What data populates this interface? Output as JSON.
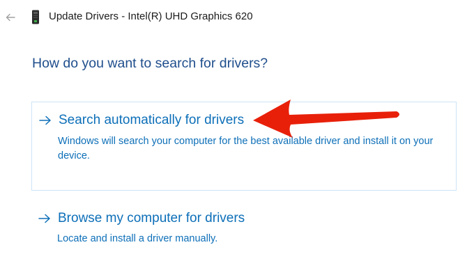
{
  "window": {
    "title": "Update Drivers - Intel(R) UHD Graphics 620",
    "back_icon": "back-arrow-icon",
    "device_icon": "graphics-card-icon"
  },
  "main": {
    "question": "How do you want to search for drivers?",
    "options": [
      {
        "title": "Search automatically for drivers",
        "description": "Windows will search your computer for the best available driver and install it on your device.",
        "icon": "arrow-right-icon",
        "selected": true
      },
      {
        "title": "Browse my computer for drivers",
        "description": "Locate and install a driver manually.",
        "icon": "arrow-right-icon",
        "selected": false
      }
    ]
  },
  "annotation": {
    "icon": "red-pointer-arrow",
    "color": "#e8200a"
  },
  "colors": {
    "accent": "#0d6fb8",
    "heading": "#1f4e8c",
    "card_border": "#cce4f7"
  }
}
